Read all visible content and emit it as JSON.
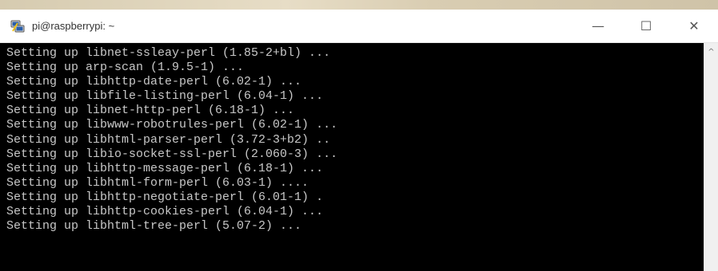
{
  "window": {
    "title": "pi@raspberrypi: ~",
    "icon": "putty-icon"
  },
  "controls": {
    "minimize_glyph": "—",
    "maximize_glyph": "☐",
    "close_glyph": "✕"
  },
  "scrollbar": {
    "up_glyph": "^"
  },
  "terminal": {
    "background": "#000000",
    "text_color": "#c8c8c8",
    "lines": [
      "Setting up libnet-ssleay-perl (1.85-2+bl) ...",
      "Setting up arp-scan (1.9.5-1) ...",
      "Setting up libhttp-date-perl (6.02-1) ...",
      "Setting up libfile-listing-perl (6.04-1) ...",
      "Setting up libnet-http-perl (6.18-1) ...",
      "Setting up libwww-robotrules-perl (6.02-1) ...",
      "Setting up libhtml-parser-perl (3.72-3+b2) ..",
      "Setting up libio-socket-ssl-perl (2.060-3) ...",
      "Setting up libhttp-message-perl (6.18-1) ...",
      "Setting up libhtml-form-perl (6.03-1) ....",
      "Setting up libhttp-negotiate-perl (6.01-1) .",
      "Setting up libhttp-cookies-perl (6.04-1) ...",
      "Setting up libhtml-tree-perl (5.07-2) ..."
    ]
  }
}
